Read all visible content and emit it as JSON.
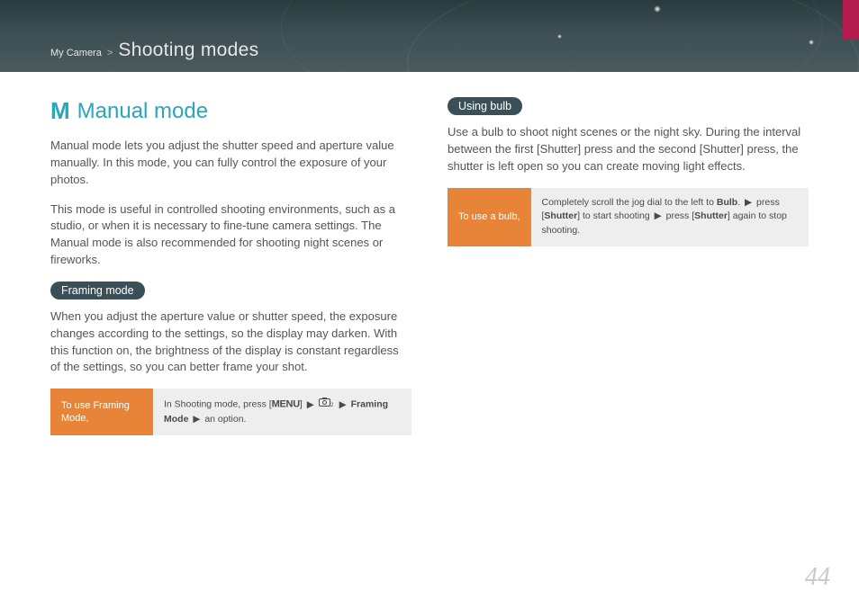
{
  "header": {
    "breadcrumb_parent": "My Camera",
    "breadcrumb_sep": ">",
    "breadcrumb_title": "Shooting modes"
  },
  "left": {
    "icon_letter": "M",
    "heading": "Manual mode",
    "p1": "Manual mode lets you adjust the shutter speed and aperture value manually. In this mode, you can fully control the exposure of your photos.",
    "p2": "This mode is useful in controlled shooting environments, such as a studio, or when it is necessary to fine-tune camera settings. The Manual mode is also recommended for shooting night scenes or fireworks.",
    "sub1_pill": "Framing mode",
    "sub1_body": "When you adjust the aperture value or shutter speed, the exposure changes according to the settings, so the display may darken. With this function on, the brightness of the display is constant regardless of the settings, so you can better frame your shot.",
    "instr1_label": "To use Framing Mode,",
    "instr1_pre": "In Shooting mode, press [",
    "instr1_menu": "MENU",
    "instr1_arrow": "▶",
    "instr1_bold": "Framing Mode",
    "instr1_tail": " an option."
  },
  "right": {
    "sub2_pill": "Using bulb",
    "sub2_body_pre": "Use a bulb to shoot night scenes or the night sky. During the interval between the first [",
    "sub2_shutter": "Shutter",
    "sub2_body_mid": "] press and the second [",
    "sub2_body_tail": "] press, the shutter is left open so you can create moving light effects.",
    "instr2_label": "To use a bulb,",
    "instr2_pre": "Completely scroll the jog dial to the left to ",
    "instr2_bulb": "Bulb",
    "instr2_dot": ". ",
    "instr2_arrow": "▶",
    "instr2_press": " press [",
    "instr2_mid": "] to start shooting ",
    "instr2_tail": "] again to stop shooting."
  },
  "page_number": "44"
}
